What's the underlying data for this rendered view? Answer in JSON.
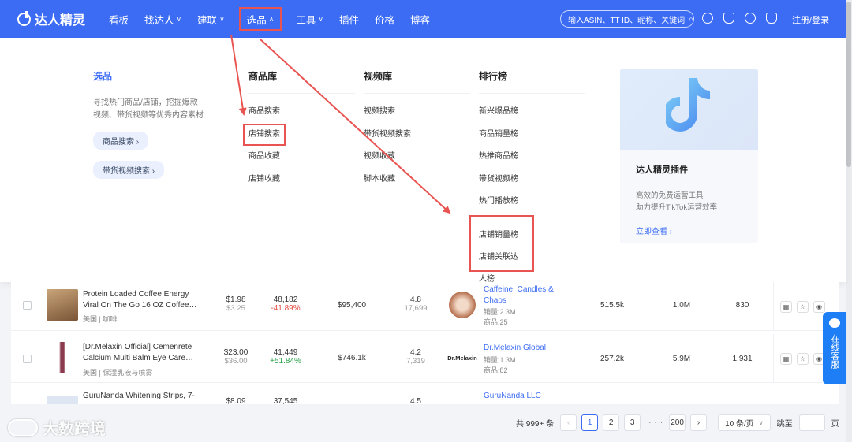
{
  "header": {
    "logo_text": "达人精灵",
    "nav": [
      {
        "label": "看板",
        "chevron": false
      },
      {
        "label": "找达人",
        "chevron": true
      },
      {
        "label": "建联",
        "chevron": true
      },
      {
        "label": "选品",
        "chevron": true,
        "active": true
      },
      {
        "label": "工具",
        "chevron": true
      },
      {
        "label": "插件",
        "chevron": false
      },
      {
        "label": "价格",
        "chevron": false
      },
      {
        "label": "博客",
        "chevron": false
      }
    ],
    "search_placeholder": "输入ASIN、TT ID、昵称、关键词",
    "icons": [
      "globe-icon",
      "headset-icon",
      "lightbulb-icon",
      "bell-icon"
    ],
    "login": "注册/登录"
  },
  "menu": {
    "intro": {
      "title": "选品",
      "desc": "寻找热门商品/店铺，挖掘爆款视频、带货视频等优秀内容素材",
      "buttons": [
        "商品搜索 ›",
        "带货视频搜索 ›"
      ]
    },
    "columns": [
      {
        "title": "商品库",
        "items": [
          "商品搜索",
          "店铺搜索",
          "商品收藏",
          "店铺收藏"
        ]
      },
      {
        "title": "视频库",
        "items": [
          "视频搜索",
          "带货视频搜索",
          "视频收藏",
          "脚本收藏"
        ]
      },
      {
        "title": "排行榜",
        "items": [
          "新兴爆品榜",
          "商品销量榜",
          "热推商品榜",
          "带货视频榜",
          "热门播放榜",
          "店铺销量榜",
          "店铺关联达人榜"
        ]
      }
    ],
    "card": {
      "title": "达人精灵插件",
      "desc1": "高效的免费运营工具",
      "desc2": "助力提升TikTok运营效率",
      "link": "立即查看 ›"
    }
  },
  "rows": [
    {
      "name": "Protein Loaded Coffee Energy Viral On The Go 16 OZ Coffee…",
      "category": "美国 | 咖啡",
      "price": "$1.98",
      "price_orig": "$3.25",
      "sales": "48,182",
      "change": "-41.89%",
      "change_dir": "neg",
      "gmv": "$95,400",
      "rating": "4.8",
      "reviews": "17,699",
      "shop": "Caffeine, Candles & Chaos",
      "shop_sales": "销量:2.3M",
      "shop_items": "商品:25",
      "c1": "515.5k",
      "c2": "1.0M",
      "c3": "830"
    },
    {
      "name": "[Dr.Melaxin Official] Cemenrete Calcium Multi Balm Eye Care…",
      "category": "美国 | 保湿乳液与喷雾",
      "price": "$23.00",
      "price_orig": "$36.00",
      "sales": "41,449",
      "change": "+51.84%",
      "change_dir": "pos",
      "gmv": "$746.1k",
      "rating": "4.2",
      "reviews": "7,319",
      "shop_logo_text": "Dr.Melaxin",
      "shop": "Dr.Melaxin Global",
      "shop_sales": "销量:1.3M",
      "shop_items": "商品:82",
      "c1": "257.2k",
      "c2": "5.9M",
      "c3": "1,931"
    },
    {
      "name": "GuruNanda Whitening Strips, 7-",
      "price": "$8.09",
      "sales": "37,545",
      "rating": "4.5",
      "shop": "GuruNanda LLC"
    }
  ],
  "pager": {
    "total": "共 999+ 条",
    "pages": [
      "1",
      "2",
      "3"
    ],
    "last": "200",
    "page_size": "10 条/页",
    "goto": "跳至",
    "page_unit": "页"
  },
  "chat": "在线客服",
  "watermark": "大数跨境",
  "colors": {
    "brand": "#3c6cf3",
    "highlight": "#e85452",
    "negative": "#e2453d",
    "positive": "#2aa34a"
  }
}
